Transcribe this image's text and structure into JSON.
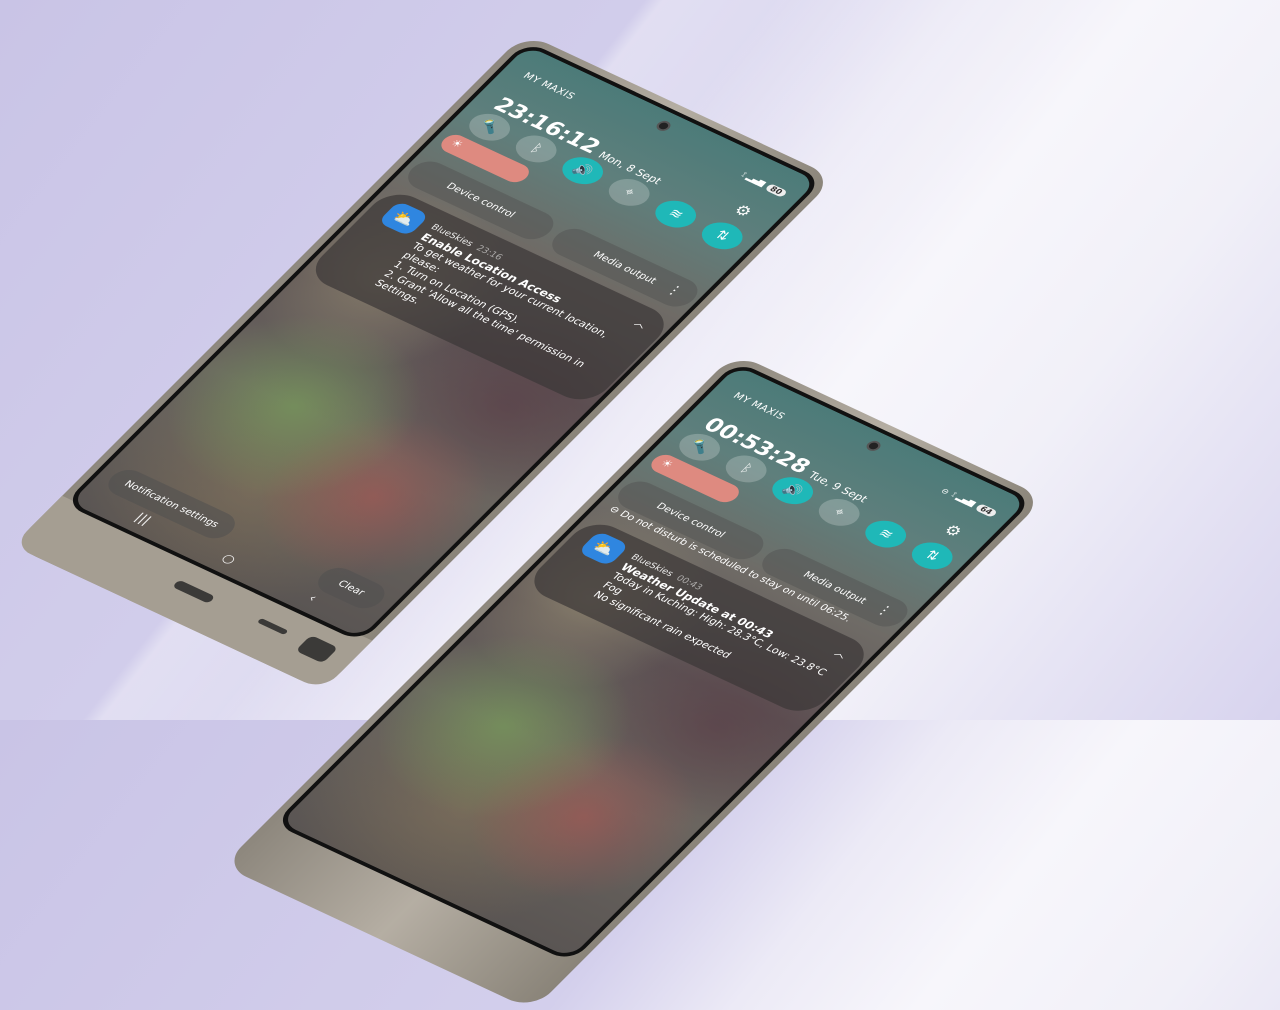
{
  "phones": [
    {
      "carrier": "MY MAXIS",
      "time": "23:16:12",
      "date": "Mon, 8 Sept",
      "battery": "80",
      "quick_settings": [
        "flashlight-icon",
        "bluetooth-icon",
        "sound-icon",
        "location-icon",
        "wifi-icon",
        "mobile-data-icon"
      ],
      "device_control": "Device control",
      "media_output": "Media output",
      "notification": {
        "app": "BlueSkies",
        "time": "23:16",
        "title": "Enable Location Access",
        "body": [
          "To get weather for your current location, please:",
          "1. Turn on Location (GPS).",
          "2. Grant 'Allow all the time' permission in Settings."
        ]
      },
      "notification_settings": "Notification settings",
      "clear": "Clear"
    },
    {
      "carrier": "MY MAXIS",
      "time": "00:53:28",
      "date": "Tue, 9 Sept",
      "battery": "64",
      "device_control": "Device control",
      "media_output": "Media output",
      "dnd": "Do not disturb is scheduled to stay on until 06:25.",
      "notification": {
        "app": "BlueSkies",
        "time": "00:43",
        "title": "Weather Update at 00:43",
        "body": [
          "Today in Kuching: High: 28.3°C, Low: 23.8°C",
          "Fog",
          "No significant rain expected"
        ]
      }
    }
  ],
  "colors": {
    "accent": "#1fb8b8",
    "brightness": "#de8a80",
    "background": "#cfcbe8"
  }
}
